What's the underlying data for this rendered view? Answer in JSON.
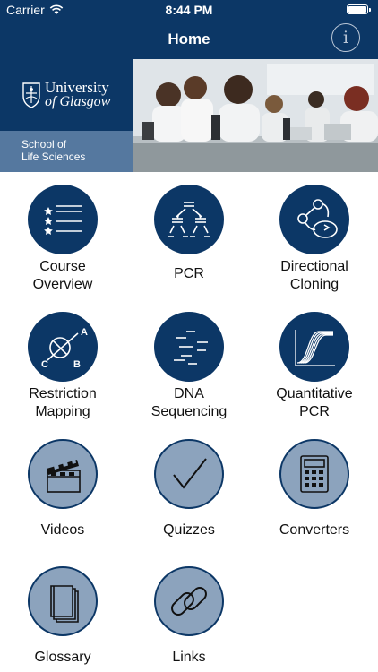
{
  "status_bar": {
    "carrier": "Carrier",
    "time": "8:44 PM",
    "battery_level": 1.0
  },
  "nav": {
    "title": "Home"
  },
  "banner": {
    "university_line1": "University",
    "university_line2": "of Glasgow",
    "school_line1": "School of",
    "school_line2": "Life Sciences"
  },
  "menu": [
    {
      "line1": "Course",
      "line2": "Overview",
      "icon": "course-overview-icon"
    },
    {
      "line1": "PCR",
      "line2": "",
      "icon": "pcr-icon"
    },
    {
      "line1": "Directional",
      "line2": "Cloning",
      "icon": "directional-cloning-icon"
    },
    {
      "line1": "Restriction",
      "line2": "Mapping",
      "icon": "restriction-mapping-icon",
      "icon_letters": [
        "A",
        "B",
        "C"
      ]
    },
    {
      "line1": "DNA",
      "line2": "Sequencing",
      "icon": "dna-sequencing-icon"
    },
    {
      "line1": "Quantitative",
      "line2": "PCR",
      "icon": "quantitative-pcr-icon"
    },
    {
      "line1": "Videos",
      "line2": "",
      "icon": "clapperboard-icon"
    },
    {
      "line1": "Quizzes",
      "line2": "",
      "icon": "checkmark-icon"
    },
    {
      "line1": "Converters",
      "line2": "",
      "icon": "calculator-icon"
    },
    {
      "line1": "Glossary",
      "line2": "",
      "icon": "book-icon"
    },
    {
      "line1": "Links",
      "line2": "",
      "icon": "chain-link-icon"
    }
  ],
  "colors": {
    "navy": "#0c3766",
    "light_tile": "#8ca3bd",
    "school_band": "#55789f"
  }
}
